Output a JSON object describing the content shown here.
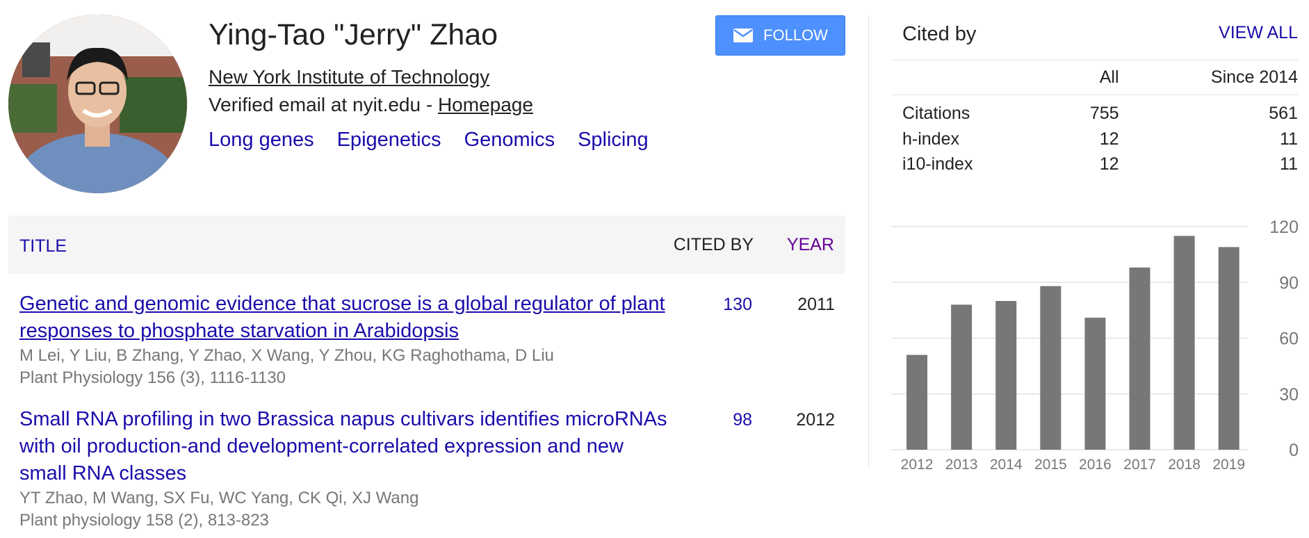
{
  "profile": {
    "name": "Ying-Tao \"Jerry\" Zhao",
    "affiliation": "New York Institute of Technology",
    "email_text": "Verified email at nyit.edu - ",
    "homepage_label": "Homepage",
    "interests": [
      "Long genes",
      "Epigenetics",
      "Genomics",
      "Splicing"
    ]
  },
  "follow_button": {
    "label": "FOLLOW",
    "icon": "mail-icon",
    "color": "#4d90fe"
  },
  "table_header": {
    "title": "TITLE",
    "cited_by": "CITED BY",
    "year": "YEAR"
  },
  "publications": [
    {
      "title": "Genetic and genomic evidence that sucrose is a global regulator of plant responses to phosphate starvation in Arabidopsis",
      "authors": "M Lei, Y Liu, B Zhang, Y Zhao, X Wang, Y Zhou, KG Raghothama, D Liu",
      "venue": "Plant Physiology 156 (3), 1116-1130",
      "cited_by": "130",
      "year": "2011"
    },
    {
      "title": "Small RNA profiling in two Brassica napus cultivars identifies microRNAs with oil production-and development-correlated expression and new small RNA classes",
      "authors": "YT Zhao, M Wang, SX Fu, WC Yang, CK Qi, XJ Wang",
      "venue": "Plant physiology 158 (2), 813-823",
      "cited_by": "98",
      "year": "2012"
    }
  ],
  "cited_by": {
    "title": "Cited by",
    "view_all": "VIEW ALL",
    "columns": [
      "",
      "All",
      "Since 2014"
    ],
    "rows": [
      {
        "label": "Citations",
        "all": "755",
        "since": "561"
      },
      {
        "label": "h-index",
        "all": "12",
        "since": "11"
      },
      {
        "label": "i10-index",
        "all": "12",
        "since": "11"
      }
    ]
  },
  "chart_data": {
    "type": "bar",
    "categories": [
      "2012",
      "2013",
      "2014",
      "2015",
      "2016",
      "2017",
      "2018",
      "2019"
    ],
    "values": [
      51,
      78,
      80,
      88,
      71,
      98,
      115,
      109
    ],
    "ylim": [
      0,
      120
    ],
    "yticks": [
      "0",
      "30",
      "60",
      "90",
      "120"
    ],
    "grid": true,
    "bar_color": "#777777"
  }
}
